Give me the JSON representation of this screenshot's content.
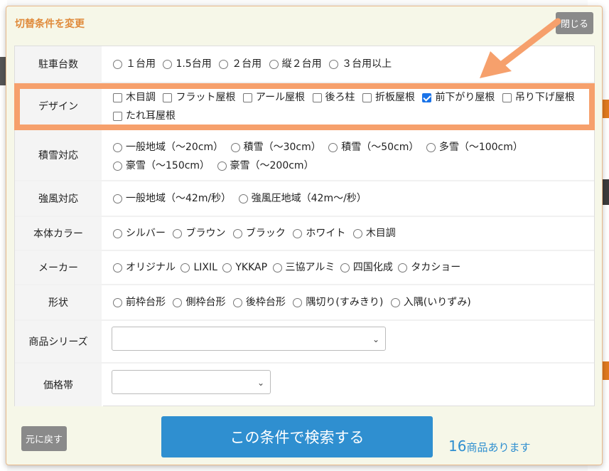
{
  "modal": {
    "title": "切替条件を変更",
    "close_label": "閉じる",
    "reset_label": "元に戻す",
    "search_label": "この条件で検索する",
    "result_count": "16",
    "result_suffix": "商品あります"
  },
  "rows": {
    "parking": {
      "label": "駐車台数",
      "options": [
        "１台用",
        "1.5台用",
        "２台用",
        "縦２台用",
        "３台用以上"
      ]
    },
    "design": {
      "label": "デザイン",
      "options": [
        "木目調",
        "フラット屋根",
        "アール屋根",
        "後ろ柱",
        "折板屋根",
        "前下がり屋根",
        "吊り下げ屋根",
        "たれ耳屋根"
      ],
      "checked": [
        false,
        false,
        false,
        false,
        false,
        true,
        false,
        false
      ]
    },
    "snow": {
      "label": "積雪対応",
      "options": [
        "一般地域（～20cm）",
        "積雪（～30cm）",
        "積雪（～50cm）",
        "多雪（～100cm）",
        "豪雪（～150cm）",
        "豪雪（～200cm）"
      ]
    },
    "wind": {
      "label": "強風対応",
      "options": [
        "一般地域（～42m/秒）",
        "強風圧地域（42m～/秒）"
      ]
    },
    "color": {
      "label": "本体カラー",
      "options": [
        "シルバー",
        "ブラウン",
        "ブラック",
        "ホワイト",
        "木目調"
      ]
    },
    "maker": {
      "label": "メーカー",
      "options": [
        "オリジナル",
        "LIXIL",
        "YKKAP",
        "三協アルミ",
        "四国化成",
        "タカショー"
      ]
    },
    "shape": {
      "label": "形状",
      "options": [
        "前枠台形",
        "側枠台形",
        "後枠台形",
        "隅切り(すみきり)",
        "入隅(いりずみ)"
      ]
    },
    "series": {
      "label": "商品シリーズ",
      "value": ""
    },
    "price": {
      "label": "価格帯",
      "value": ""
    }
  },
  "colors": {
    "accent_orange": "#f6a06c",
    "button_blue": "#2f8fd0",
    "title_orange": "#e08a3a"
  }
}
